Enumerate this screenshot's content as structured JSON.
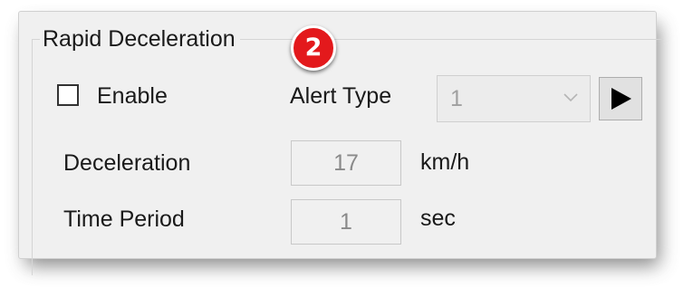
{
  "group": {
    "title": "Rapid Deceleration",
    "badge": "2"
  },
  "enable": {
    "label": "Enable",
    "checked": false
  },
  "alert_type": {
    "label": "Alert Type",
    "value": "1"
  },
  "deceleration": {
    "label": "Deceleration",
    "value": "17",
    "unit": "km/h"
  },
  "time_period": {
    "label": "Time Period",
    "value": "1",
    "unit": "sec"
  },
  "colors": {
    "panel_bg": "#f0f0f0",
    "badge_red": "#e3191c",
    "disabled_text": "#a0a0a0"
  }
}
